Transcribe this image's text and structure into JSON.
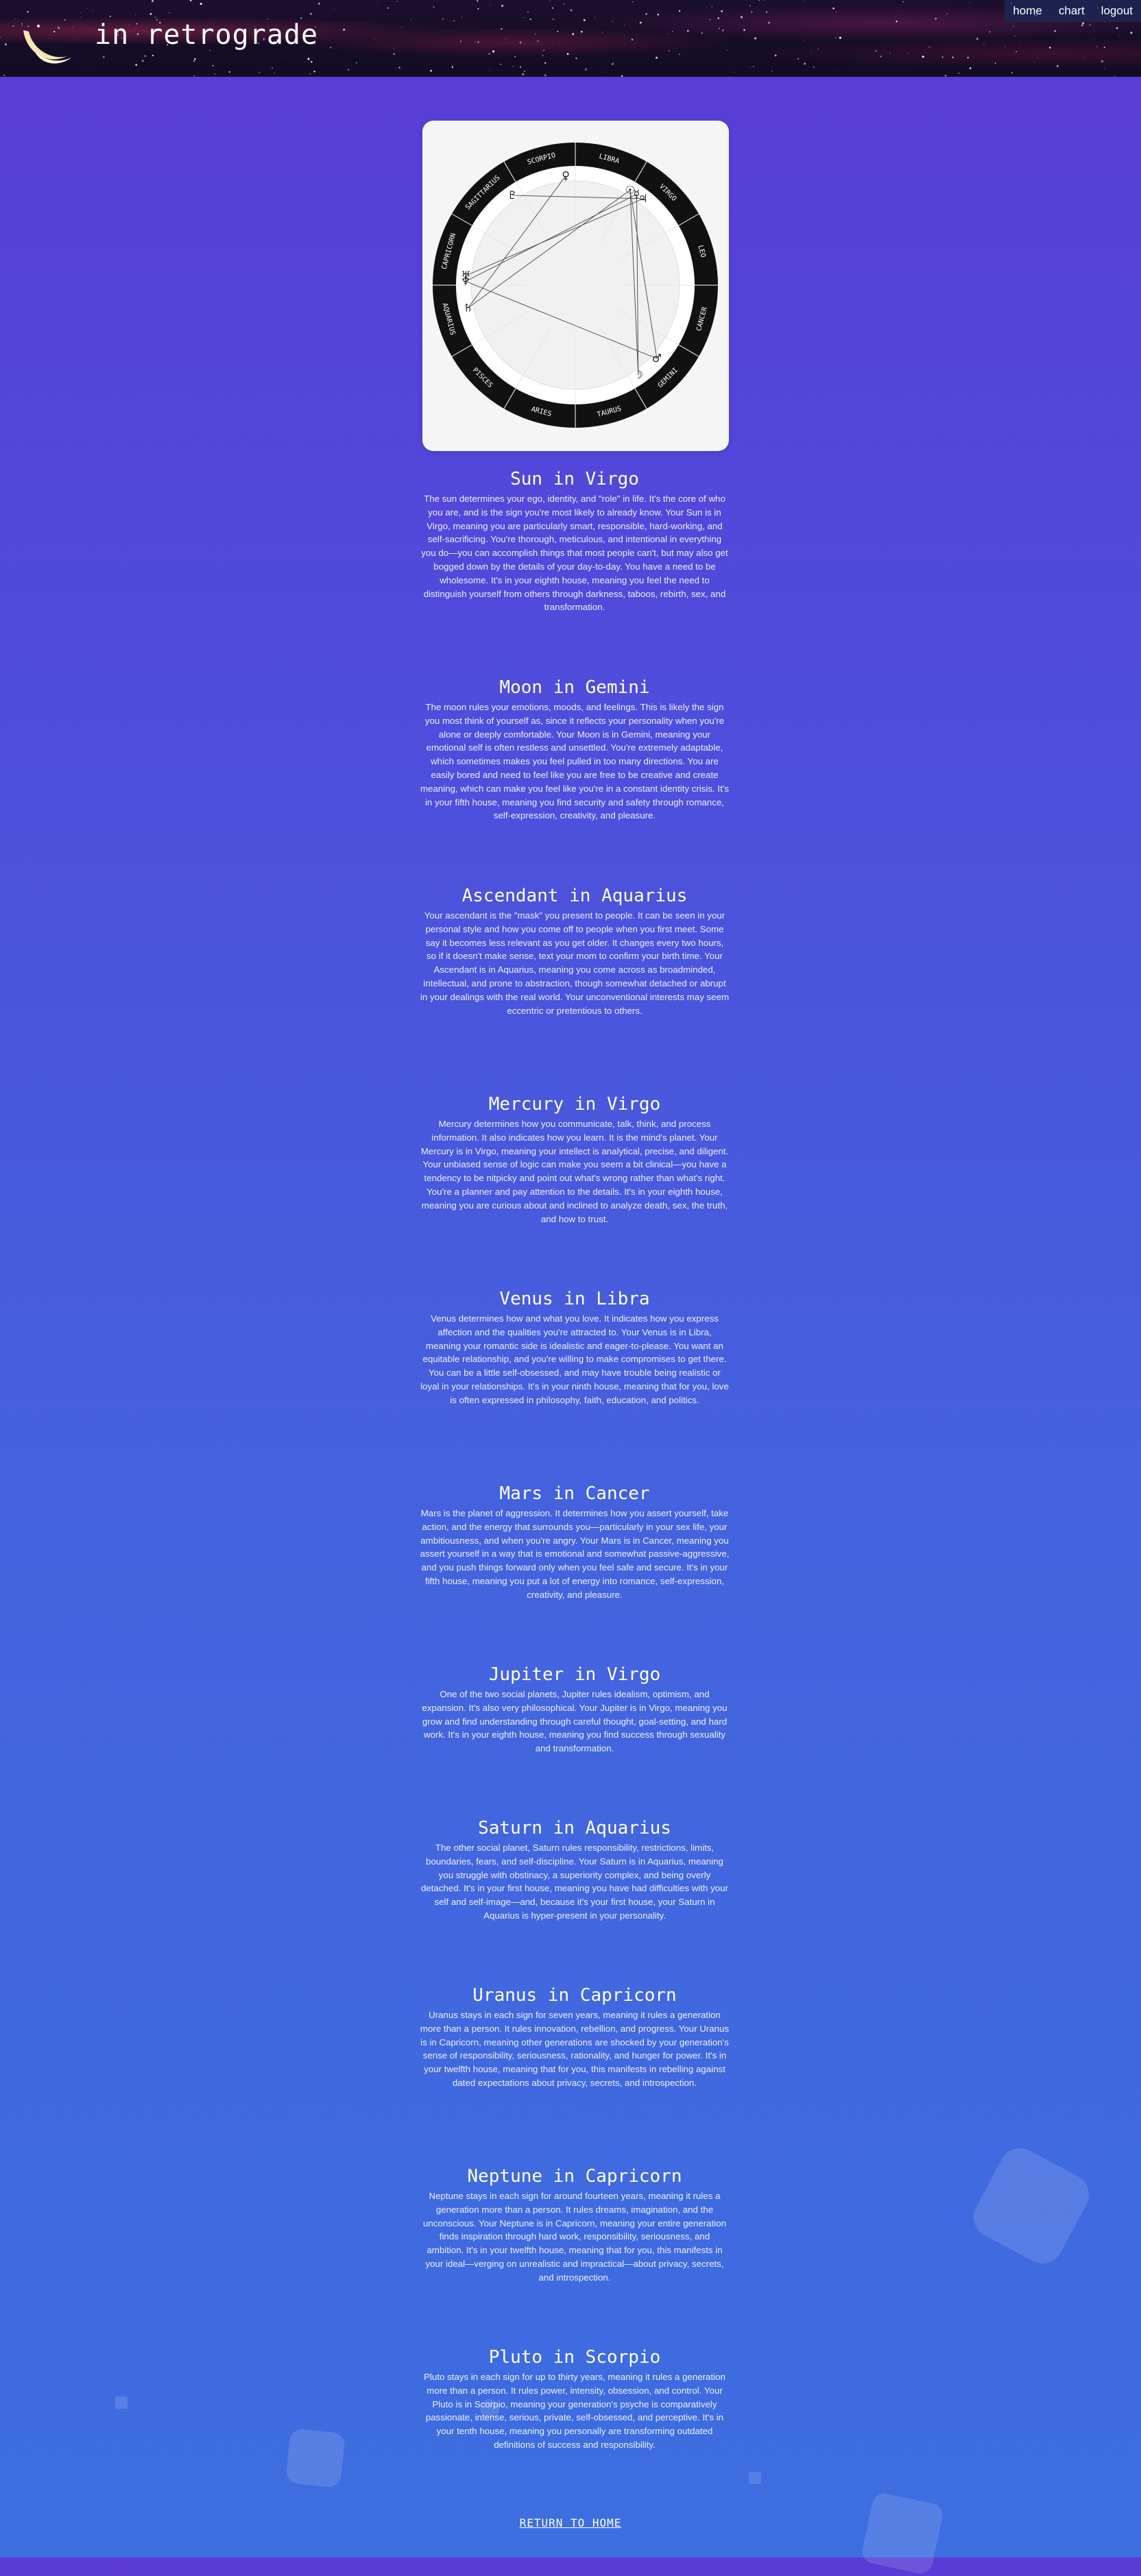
{
  "header": {
    "site_title": "in retrograde",
    "nav": [
      {
        "label": "home"
      },
      {
        "label": "chart"
      },
      {
        "label": "logout"
      }
    ]
  },
  "chart_wheel": {
    "signs": [
      "SCORPIO",
      "LIBRA",
      "VIRGO",
      "LEO",
      "CANCER",
      "GEMINI",
      "TAURUS",
      "ARIES",
      "PISCES",
      "AQUARIUS",
      "CAPRICORN",
      "SAGITTARIUS"
    ]
  },
  "placements": [
    {
      "title": "Sun in Virgo",
      "text": "The sun determines your ego, identity, and \"role\" in life. It's the core of who you are, and is the sign you're most likely to already know. Your Sun is in Virgo, meaning you are particularly smart, responsible, hard-working, and self-sacrificing. You're thorough, meticulous, and intentional in everything you do—you can accomplish things that most people can't, but may also get bogged down by the details of your day-to-day. You have a need to be wholesome. It's in your eighth house, meaning you feel the need to distinguish yourself from others through darkness, taboos, rebirth, sex, and transformation."
    },
    {
      "title": "Moon in Gemini",
      "text": "The moon rules your emotions, moods, and feelings. This is likely the sign you most think of yourself as, since it reflects your personality when you're alone or deeply comfortable. Your Moon is in Gemini, meaning your emotional self is often restless and unsettled. You're extremely adaptable, which sometimes makes you feel pulled in too many directions. You are easily bored and need to feel like you are free to be creative and create meaning, which can make you feel like you're in a constant identity crisis. It's in your fifth house, meaning you find security and safety through romance, self-expression, creativity, and pleasure."
    },
    {
      "title": "Ascendant in Aquarius",
      "text": "Your ascendant is the \"mask\" you present to people. It can be seen in your personal style and how you come off to people when you first meet. Some say it becomes less relevant as you get older. It changes every two hours, so if it doesn't make sense, text your mom to confirm your birth time. Your Ascendant is in Aquarius, meaning you come across as broadminded, intellectual, and prone to abstraction, though somewhat detached or abrupt in your dealings with the real world. Your unconventional interests may seem eccentric or pretentious to others."
    },
    {
      "title": "Mercury in Virgo",
      "text": "Mercury determines how you communicate, talk, think, and process information. It also indicates how you learn. It is the mind's planet. Your Mercury is in Virgo, meaning your intellect is analytical, precise, and diligent. Your unbiased sense of logic can make you seem a bit clinical—you have a tendency to be nitpicky and point out what's wrong rather than what's right. You're a planner and pay attention to the details. It's in your eighth house, meaning you are curious about and inclined to analyze death, sex, the truth, and how to trust."
    },
    {
      "title": "Venus in Libra",
      "text": "Venus determines how and what you love. It indicates how you express affection and the qualities you're attracted to. Your Venus is in Libra, meaning your romantic side is idealistic and eager-to-please. You want an equitable relationship, and you're willing to make compromises to get there. You can be a little self-obsessed, and may have trouble being realistic or loyal in your relationships. It's in your ninth house, meaning that for you, love is often expressed in philosophy, faith, education, and politics."
    },
    {
      "title": "Mars in Cancer",
      "text": "Mars is the planet of aggression. It determines how you assert yourself, take action, and the energy that surrounds you—particularly in your sex life, your ambitiousness, and when you're angry. Your Mars is in Cancer, meaning you assert yourself in a way that is emotional and somewhat passive-aggressive, and you push things forward only when you feel safe and secure. It's in your fifth house, meaning you put a lot of energy into romance, self-expression, creativity, and pleasure."
    },
    {
      "title": "Jupiter in Virgo",
      "text": "One of the two social planets, Jupiter rules idealism, optimism, and expansion. It's also very philosophical. Your Jupiter is in Virgo, meaning you grow and find understanding through careful thought, goal-setting, and hard work. It's in your eighth house, meaning you find success through sexuality and transformation."
    },
    {
      "title": "Saturn in Aquarius",
      "text": "The other social planet, Saturn rules responsibility, restrictions, limits, boundaries, fears, and self-discipline. Your Saturn is in Aquarius, meaning you struggle with obstinacy, a superiority complex, and being overly detached. It's in your first house, meaning you have had difficulties with your self and self-image—and, because it's your first house, your Saturn in Aquarius is hyper-present in your personality."
    },
    {
      "title": "Uranus in Capricorn",
      "text": "Uranus stays in each sign for seven years, meaning it rules a generation more than a person. It rules innovation, rebellion, and progress. Your Uranus is in Capricorn, meaning other generations are shocked by your generation's sense of responsibility, seriousness, rationality, and hunger for power. It's in your twelfth house, meaning that for you, this manifests in rebelling against dated expectations about privacy, secrets, and introspection."
    },
    {
      "title": "Neptune in Capricorn",
      "text": "Neptune stays in each sign for around fourteen years, meaning it rules a generation more than a person. It rules dreams, imagination, and the unconscious. Your Neptune is in Capricorn, meaning your entire generation finds inspiration through hard work, responsibility, seriousness, and ambition. It's in your twelfth house, meaning that for you, this manifests in your ideal—verging on unrealistic and impractical—about privacy, secrets, and introspection."
    },
    {
      "title": "Pluto in Scorpio",
      "text": "Pluto stays in each sign for up to thirty years, meaning it rules a generation more than a person. It rules power, intensity, obsession, and control. Your Pluto is in Scorpio, meaning your generation's psyche is comparatively passionate, intense, serious, private, self-obsessed, and perceptive. It's in your tenth house, meaning you personally are transforming outdated definitions of success and responsibility."
    }
  ],
  "footer": {
    "return_label": "RETURN TO HOME"
  }
}
